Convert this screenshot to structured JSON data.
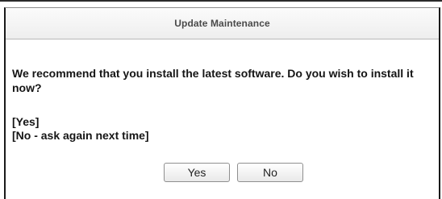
{
  "dialog": {
    "title": "Update Maintenance",
    "message": "We recommend that you install the latest software. Do you wish to install it now?",
    "options": [
      "[Yes]",
      "[No - ask again next time]"
    ],
    "buttons": {
      "yes": "Yes",
      "no": "No"
    }
  }
}
